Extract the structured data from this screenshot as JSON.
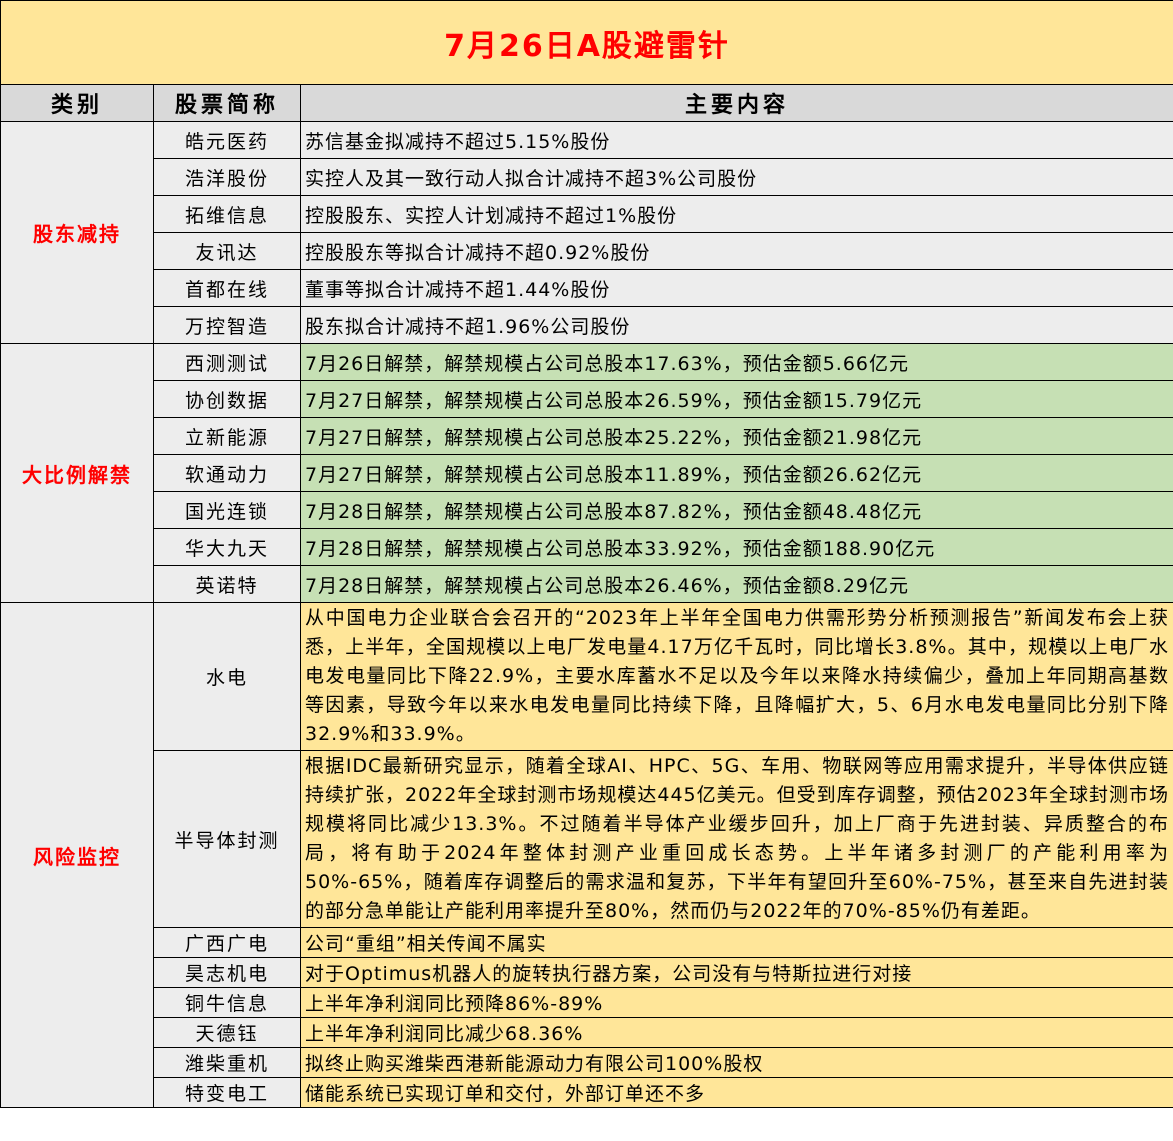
{
  "title": "7月26日A股避雷针",
  "headers": [
    "类别",
    "股票简称",
    "主要内容"
  ],
  "groups": [
    {
      "category": "股东减持",
      "rows": [
        {
          "name": "皓元医药",
          "content": "苏信基金拟减持不超过5.15%股份"
        },
        {
          "name": "浩洋股份",
          "content": "实控人及其一致行动人拟合计减持不超3%公司股份"
        },
        {
          "name": "拓维信息",
          "content": "控股股东、实控人计划减持不超过1%股份"
        },
        {
          "name": "友讯达",
          "content": "控股股东等拟合计减持不超0.92%股份"
        },
        {
          "name": "首都在线",
          "content": "董事等拟合计减持不超1.44%股份"
        },
        {
          "name": "万控智造",
          "content": "股东拟合计减持不超1.96%公司股份"
        }
      ]
    },
    {
      "category": "大比例解禁",
      "rows": [
        {
          "name": "西测测试",
          "content": "7月26日解禁，解禁规模占公司总股本17.63%，预估金额5.66亿元"
        },
        {
          "name": "协创数据",
          "content": "7月27日解禁，解禁规模占公司总股本26.59%，预估金额15.79亿元"
        },
        {
          "name": "立新能源",
          "content": "7月27日解禁，解禁规模占公司总股本25.22%，预估金额21.98亿元"
        },
        {
          "name": "软通动力",
          "content": "7月27日解禁，解禁规模占公司总股本11.89%，预估金额26.62亿元"
        },
        {
          "name": "国光连锁",
          "content": "7月28日解禁，解禁规模占公司总股本87.82%，预估金额48.48亿元"
        },
        {
          "name": "华大九天",
          "content": "7月28日解禁，解禁规模占公司总股本33.92%，预估金额188.90亿元"
        },
        {
          "name": "英诺特",
          "content": "7月28日解禁，解禁规模占公司总股本26.46%，预估金额8.29亿元"
        }
      ]
    },
    {
      "category": "风险监控",
      "rows": [
        {
          "name": "水电",
          "content": "从中国电力企业联合会召开的“2023年上半年全国电力供需形势分析预测报告”新闻发布会上获悉，上半年，全国规模以上电厂发电量4.17万亿千瓦时，同比增长3.8%。其中，规模以上电厂水电发电量同比下降22.9%，主要水库蓄水不足以及今年以来降水持续偏少，叠加上年同期高基数等因素，导致今年以来水电发电量同比持续下降，且降幅扩大，5、6月水电发电量同比分别下降32.9%和33.9%。"
        },
        {
          "name": "半导体封测",
          "content": "根据IDC最新研究显示，随着全球AI、HPC、5G、车用、物联网等应用需求提升，半导体供应链持续扩张，2022年全球封测市场规模达445亿美元。但受到库存调整，预估2023年全球封测市场规模将同比减少13.3%。不过随着半导体产业缓步回升，加上厂商于先进封装、异质整合的布局，将有助于2024年整体封测产业重回成长态势。上半年诸多封测厂的产能利用率为50%-65%，随着库存调整后的需求温和复苏，下半年有望回升至60%-75%，甚至来自先进封装的部分急单能让产能利用率提升至80%，然而仍与2022年的70%-85%仍有差距。"
        },
        {
          "name": "广西广电",
          "content": "公司“重组”相关传闻不属实"
        },
        {
          "name": "昊志机电",
          "content": "对于Optimus机器人的旋转执行器方案，公司没有与特斯拉进行对接"
        },
        {
          "name": "铜牛信息",
          "content": "上半年净利润同比预降86%-89%"
        },
        {
          "name": "天德钰",
          "content": "上半年净利润同比减少68.36%"
        },
        {
          "name": "潍柴重机",
          "content": "拟终止购买潍柴西港新能源动力有限公司100%股权"
        },
        {
          "name": "特变电工",
          "content": "储能系统已实现订单和交付，外部订单还不多"
        }
      ]
    }
  ]
}
